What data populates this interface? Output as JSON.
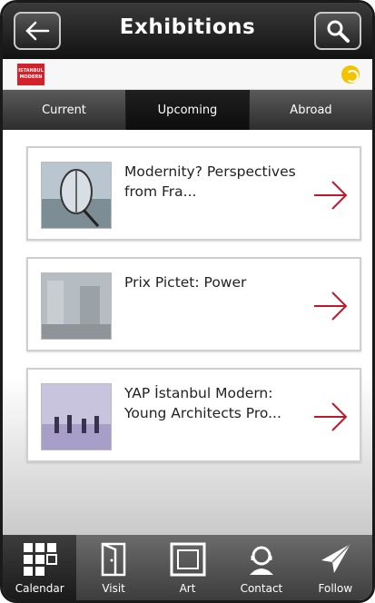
{
  "header": {
    "title": "Exhibitions"
  },
  "brand": {
    "logo_text": "ISTANBUL MODERN"
  },
  "tabs": [
    {
      "label": "Current"
    },
    {
      "label": "Upcoming"
    },
    {
      "label": "Abroad"
    }
  ],
  "exhibitions": [
    {
      "title": "Modernity? Perspectives from Fra..."
    },
    {
      "title": "Prix Pictet: Power"
    },
    {
      "title": "YAP İstanbul Modern: Young Architects Pro..."
    }
  ],
  "nav": [
    {
      "label": "Calendar",
      "icon": "calendar-icon"
    },
    {
      "label": "Visit",
      "icon": "door-icon"
    },
    {
      "label": "Art",
      "icon": "frame-icon"
    },
    {
      "label": "Contact",
      "icon": "headset-icon"
    },
    {
      "label": "Follow",
      "icon": "paper-plane-icon"
    }
  ],
  "colors": {
    "accent_arrow": "#c0182b",
    "brand_red": "#d4212a"
  }
}
